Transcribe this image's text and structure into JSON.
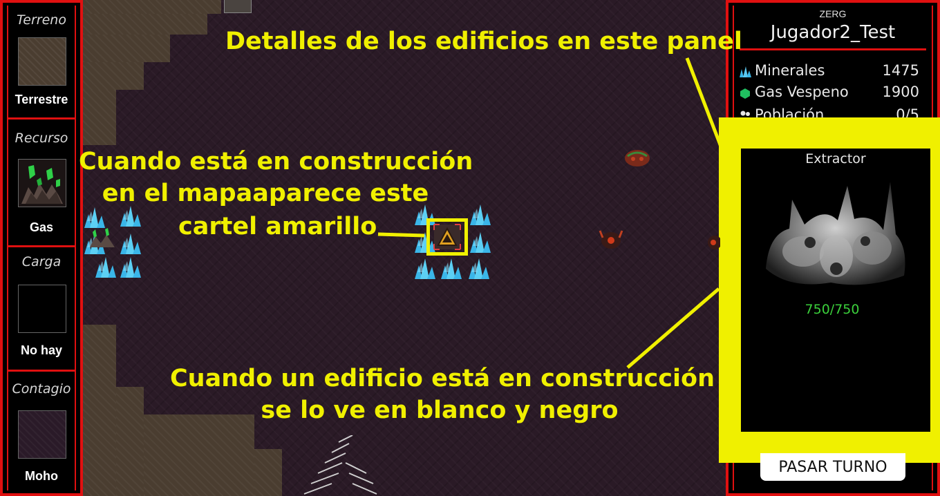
{
  "left_panel": {
    "terrain": {
      "title": "Terreno",
      "value": "Terrestre"
    },
    "resource": {
      "title": "Recurso",
      "value": "Gas"
    },
    "cargo": {
      "title": "Carga",
      "value": "No hay"
    },
    "contagion": {
      "title": "Contagio",
      "value": "Moho"
    }
  },
  "right_panel": {
    "race": "ZERG",
    "player_name": "Jugador2_Test",
    "resources": [
      {
        "label": "Minerales",
        "value": "1475",
        "icon": "mineral-crystal-icon"
      },
      {
        "label": "Gas Vespeno",
        "value": "1900",
        "icon": "vespene-gas-icon"
      },
      {
        "label": "Población",
        "value": "0/5",
        "icon": "population-icon"
      }
    ],
    "selected_building": {
      "name": "Extractor",
      "hp": "750/750"
    },
    "pass_turn_label": "PASAR TURNO"
  },
  "annotations": {
    "panel_note": "Detalles de los edificios en este panel",
    "map_note_line1": "Cuando está en construcción",
    "map_note_line2": "en el mapaaparece este",
    "map_note_line3": "cartel amarillo",
    "grayscale_note_line1": "Cuando un edificio está en construcción",
    "grayscale_note_line2": "se lo ve en blanco y negro"
  },
  "colors": {
    "frame_red": "#e01010",
    "highlight_yellow": "#f0f000",
    "hp_green": "#3bd03b",
    "crystal_blue": "#3ab6e8"
  }
}
